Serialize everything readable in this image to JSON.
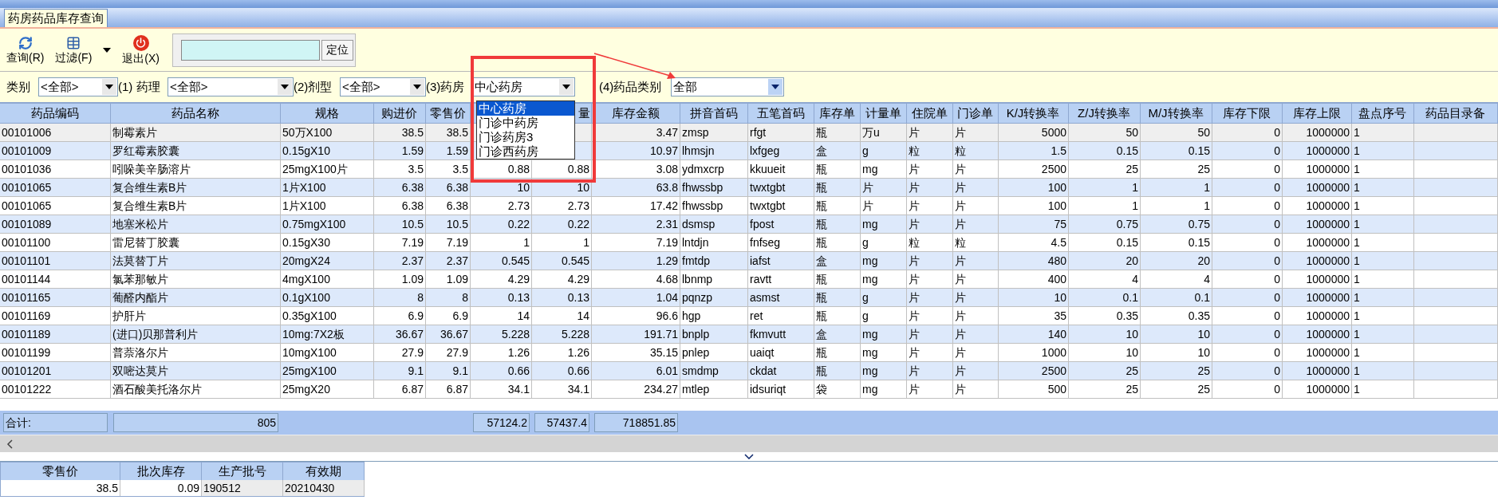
{
  "tab": {
    "label": "药房药品库存查询",
    "selected": true
  },
  "toolbar": {
    "buttons": [
      {
        "kind": "refresh",
        "label": "查询(R)"
      },
      {
        "kind": "filter",
        "label": "过滤(F)"
      },
      {
        "kind": "menu"
      },
      {
        "kind": "exit",
        "label": "退出(X)"
      }
    ],
    "locate": {
      "button": "定位"
    }
  },
  "filters": [
    {
      "label": "类别",
      "value": "<全部>",
      "focused": false
    },
    {
      "label": "(1) 药理",
      "value": "<全部>",
      "focused": false
    },
    {
      "label": "(2)剂型",
      "value": "<全部>",
      "focused": false
    },
    {
      "label": "(3)药房",
      "value": "中心药房",
      "focused": false,
      "options": [
        {
          "label": "中心药房",
          "selected": true
        },
        {
          "label": "门诊中药房",
          "selected": false
        },
        {
          "label": "门诊药房3",
          "selected": false
        },
        {
          "label": "门诊西药房",
          "selected": false
        }
      ]
    },
    {
      "label": "(4)药品类别",
      "value": "全部",
      "focused": true
    }
  ],
  "table": {
    "columns": [
      {
        "label": "药品编码"
      },
      {
        "label": "药品名称"
      },
      {
        "label": "规格"
      },
      {
        "label": "购进价"
      },
      {
        "label": "零售价"
      },
      {},
      {
        "label": "量"
      },
      {
        "label": "库存金额"
      },
      {
        "label": "拼音首码"
      },
      {
        "label": "五笔首码"
      },
      {
        "label": "库存单"
      },
      {
        "label": "计量单"
      },
      {
        "label": "住院单"
      },
      {
        "label": "门诊单"
      },
      {
        "label": "K/J转换率"
      },
      {
        "label": "Z/J转换率"
      },
      {
        "label": "M/J转换率"
      },
      {
        "label": "库存下限"
      },
      {
        "label": "库存上限"
      },
      {
        "label": "盘点序号"
      },
      {
        "label": "药品目录备"
      }
    ],
    "rows": [
      {
        "selected": true,
        "cells": [
          "00101006",
          "制霉素片",
          "50万X100",
          "38.5",
          "38.5",
          null,
          null,
          "3.47",
          "zmsp",
          "rfgt",
          "瓶",
          "万u",
          "片",
          "片",
          "5000",
          "50",
          "50",
          "0",
          "1000000",
          "1"
        ]
      },
      {
        "selected": false,
        "cells": [
          "00101009",
          "罗红霉素胶囊",
          "0.15gX10",
          "1.59",
          "1.59",
          null,
          null,
          "10.97",
          "lhmsjn",
          "lxfgeg",
          "盒",
          "g",
          "粒",
          "粒",
          "1.5",
          "0.15",
          "0.15",
          "0",
          "1000000",
          "1"
        ]
      },
      {
        "selected": false,
        "cells": [
          "00101036",
          "吲哚美辛肠溶片",
          "25mgX100片",
          "3.5",
          "3.5",
          "0.88",
          "0.88",
          "3.08",
          "ydmxcrp",
          "kkuueit",
          "瓶",
          "mg",
          "片",
          "片",
          "2500",
          "25",
          "25",
          "0",
          "1000000",
          "1"
        ]
      },
      {
        "selected": false,
        "cells": [
          "00101065",
          "复合维生素B片",
          "1片X100",
          "6.38",
          "6.38",
          "10",
          "10",
          "63.8",
          "fhwssbp",
          "twxtgbt",
          "瓶",
          "片",
          "片",
          "片",
          "100",
          "1",
          "1",
          "0",
          "1000000",
          "1"
        ]
      },
      {
        "selected": false,
        "cells": [
          "00101065",
          "复合维生素B片",
          "1片X100",
          "6.38",
          "6.38",
          "2.73",
          "2.73",
          "17.42",
          "fhwssbp",
          "twxtgbt",
          "瓶",
          "片",
          "片",
          "片",
          "100",
          "1",
          "1",
          "0",
          "1000000",
          "1"
        ]
      },
      {
        "selected": false,
        "cells": [
          "00101089",
          "地塞米松片",
          "0.75mgX100",
          "10.5",
          "10.5",
          "0.22",
          "0.22",
          "2.31",
          "dsmsp",
          "fpost",
          "瓶",
          "mg",
          "片",
          "片",
          "75",
          "0.75",
          "0.75",
          "0",
          "1000000",
          "1"
        ]
      },
      {
        "selected": false,
        "cells": [
          "00101100",
          "雷尼替丁胶囊",
          "0.15gX30",
          "7.19",
          "7.19",
          "1",
          "1",
          "7.19",
          "lntdjn",
          "fnfseg",
          "瓶",
          "g",
          "粒",
          "粒",
          "4.5",
          "0.15",
          "0.15",
          "0",
          "1000000",
          "1"
        ]
      },
      {
        "selected": false,
        "cells": [
          "00101101",
          "法莫替丁片",
          "20mgX24",
          "2.37",
          "2.37",
          "0.545",
          "0.545",
          "1.29",
          "fmtdp",
          "iafst",
          "盒",
          "mg",
          "片",
          "片",
          "480",
          "20",
          "20",
          "0",
          "1000000",
          "1"
        ]
      },
      {
        "selected": false,
        "cells": [
          "00101144",
          "氯苯那敏片",
          "4mgX100",
          "1.09",
          "1.09",
          "4.29",
          "4.29",
          "4.68",
          "lbnmp",
          "ravtt",
          "瓶",
          "mg",
          "片",
          "片",
          "400",
          "4",
          "4",
          "0",
          "1000000",
          "1"
        ]
      },
      {
        "selected": false,
        "cells": [
          "00101165",
          "葡醛内酯片",
          "0.1gX100",
          "8",
          "8",
          "0.13",
          "0.13",
          "1.04",
          "pqnzp",
          "asmst",
          "瓶",
          "g",
          "片",
          "片",
          "10",
          "0.1",
          "0.1",
          "0",
          "1000000",
          "1"
        ]
      },
      {
        "selected": false,
        "cells": [
          "00101169",
          "护肝片",
          "0.35gX100",
          "6.9",
          "6.9",
          "14",
          "14",
          "96.6",
          "hgp",
          "ret",
          "瓶",
          "g",
          "片",
          "片",
          "35",
          "0.35",
          "0.35",
          "0",
          "1000000",
          "1"
        ]
      },
      {
        "selected": false,
        "cells": [
          "00101189",
          "(进口)贝那普利片",
          "10mg:7X2板",
          "36.67",
          "36.67",
          "5.228",
          "5.228",
          "191.71",
          "bnplp",
          "fkmvutt",
          "盒",
          "mg",
          "片",
          "片",
          "140",
          "10",
          "10",
          "0",
          "1000000",
          "1"
        ]
      },
      {
        "selected": false,
        "cells": [
          "00101199",
          "普萘洛尔片",
          "10mgX100",
          "27.9",
          "27.9",
          "1.26",
          "1.26",
          "35.15",
          "pnlep",
          "uaiqt",
          "瓶",
          "mg",
          "片",
          "片",
          "1000",
          "10",
          "10",
          "0",
          "1000000",
          "1"
        ]
      },
      {
        "selected": false,
        "cells": [
          "00101201",
          "双嘧达莫片",
          "25mgX100",
          "9.1",
          "9.1",
          "0.66",
          "0.66",
          "6.01",
          "smdmp",
          "ckdat",
          "瓶",
          "mg",
          "片",
          "片",
          "2500",
          "25",
          "25",
          "0",
          "1000000",
          "1"
        ]
      },
      {
        "selected": false,
        "cells": [
          "00101222",
          "酒石酸美托洛尔片",
          "25mgX20",
          "6.87",
          "6.87",
          "34.1",
          "34.1",
          "234.27",
          "mtlep",
          "idsuriqt",
          "袋",
          "mg",
          "片",
          "片",
          "500",
          "25",
          "25",
          "0",
          "1000000",
          "1"
        ]
      }
    ],
    "totals": {
      "label": "合计:",
      "values": [
        "805",
        "57124.2",
        "57437.4",
        "718851.85"
      ]
    }
  },
  "batch_table": {
    "columns": [
      "零售价",
      "批次库存",
      "生产批号",
      "有效期"
    ],
    "rows": [
      [
        "38.5",
        "0.09",
        "190512",
        "20210430"
      ]
    ]
  }
}
